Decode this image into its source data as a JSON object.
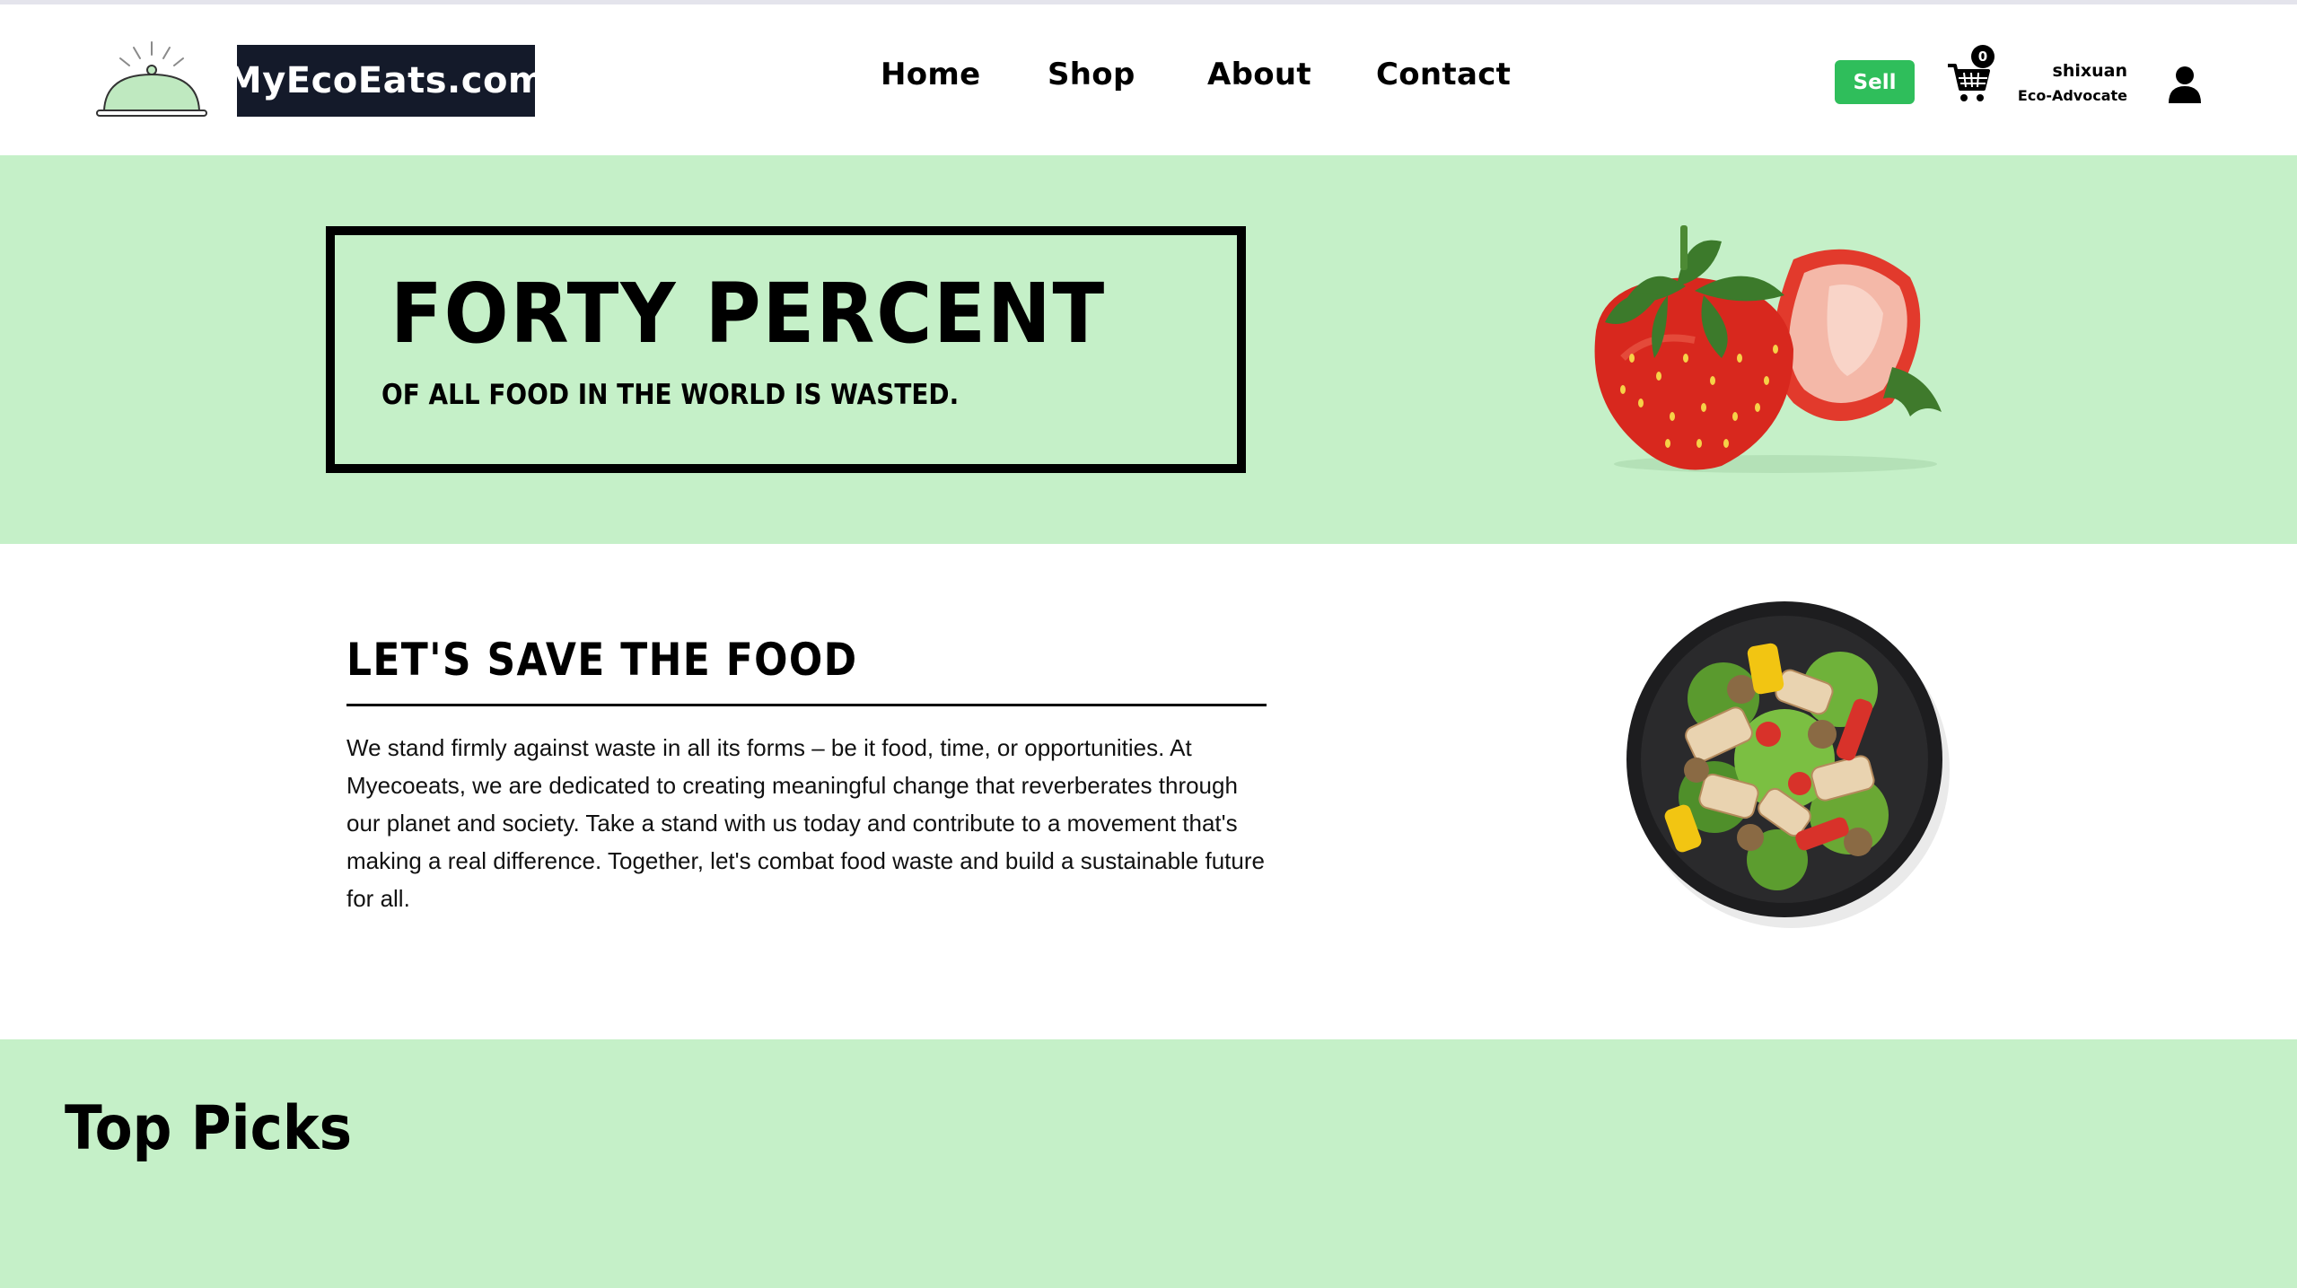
{
  "header": {
    "brand": "MyEcoEats.com",
    "nav": [
      {
        "label": "Home"
      },
      {
        "label": "Shop"
      },
      {
        "label": "About"
      },
      {
        "label": "Contact"
      }
    ],
    "sell_label": "Sell",
    "cart_count": "0",
    "user_name": "shixuan",
    "user_role": "Eco-Advocate"
  },
  "hero": {
    "title": "FORTY PERCENT",
    "subtitle": "OF ALL FOOD IN THE WORLD IS WASTED."
  },
  "mission": {
    "title": "LET'S SAVE THE FOOD",
    "body": "We stand firmly against waste in all its forms – be it food, time, or opportunities. At Myecoeats, we are dedicated to creating meaningful change that reverberates through our planet and society. Take a stand with us today and contribute to a movement that's making a real difference. Together, let's combat food waste and build a sustainable future for all."
  },
  "top_picks": {
    "title": "Top Picks"
  },
  "colors": {
    "accent_green": "#c5f0c8",
    "sell_green": "#2fbe5b",
    "brand_box": "#141a2a"
  },
  "icons": [
    "cloche-logo-icon",
    "cart-icon",
    "user-icon"
  ]
}
